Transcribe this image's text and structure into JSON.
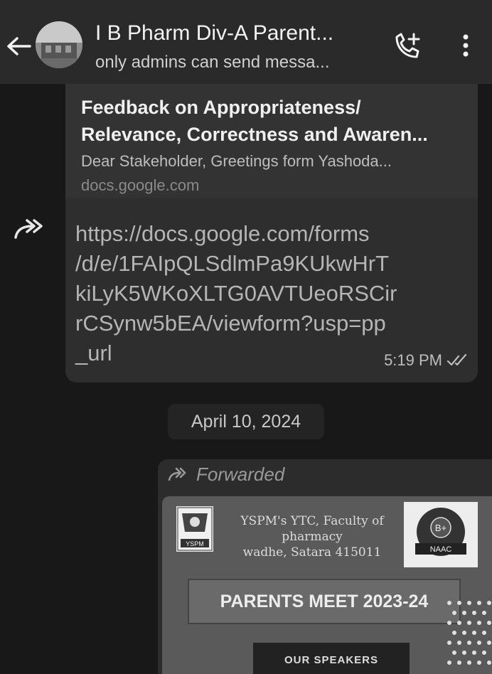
{
  "header": {
    "title": "I B Pharm Div-A Parent...",
    "subtitle": "only admins can send messa...",
    "icons": {
      "back": "arrow-left-icon",
      "call": "add-call-icon",
      "menu": "more-vert-icon"
    }
  },
  "message": {
    "preview": {
      "title_line1": "Feedback on Appropriateness/",
      "title_line2": "Relevance, Correctness and Awaren...",
      "description": "Dear Stakeholder, Greetings form Yashoda...",
      "domain": "docs.google.com"
    },
    "link_lines": [
      "https://docs.google.com/forms",
      "/d/e/1FAIpQLSdlmPa9KUkwHrT",
      "kiLyK5WKoXLTG0AVTUeoRSCir",
      "rCSynw5bEA/viewform?usp=pp",
      "_url"
    ],
    "time": "5:19 PM",
    "status_icon": "double-check-icon"
  },
  "date_separator": "April 10, 2024",
  "forwarded_message": {
    "label": "Forwarded",
    "flyer": {
      "org_line1": "YSPM's YTC, Faculty of",
      "org_line2": "pharmacy",
      "org_line3": "wadhe, Satara 415011",
      "logo_left_text": "YSPM",
      "badge_grade": "B+",
      "badge_text": "NAAC",
      "headline": "PARENTS MEET 2023-24",
      "speakers": "OUR SPEAKERS"
    }
  },
  "colors": {
    "background": "#181818",
    "header": "#2a2a2a",
    "bubble": "#2e2e2e"
  }
}
